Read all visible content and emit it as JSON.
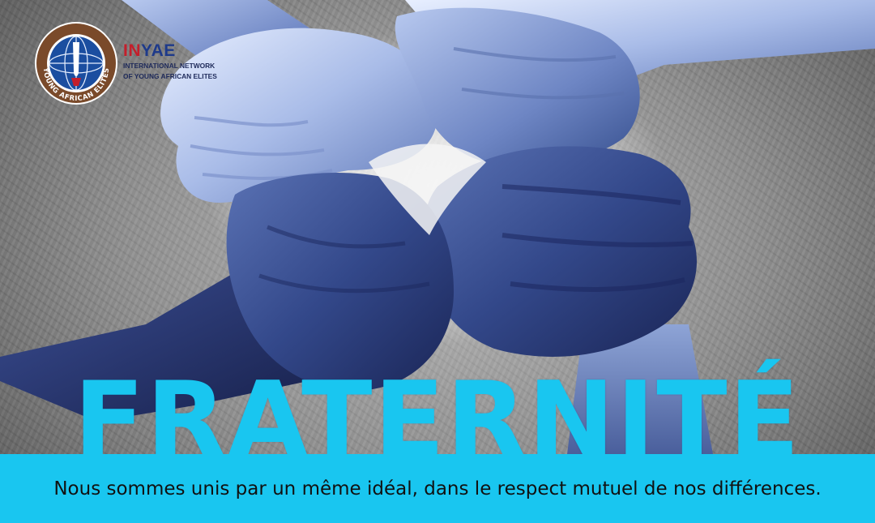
{
  "brand": {
    "logo_ring_text": "YOUNG AFRICAN ELITES",
    "acronym_part1": "IN",
    "acronym_part2": "YAE",
    "subtitle_line1": "INTERNATIONAL NETWORK",
    "subtitle_line2": "OF YOUNG AFRICAN ELITES"
  },
  "headline": "FRATERNITÉ",
  "caption": "Nous sommes unis par un même idéal, dans le respect mutuel de nos différences.",
  "colors": {
    "accent_cyan": "#19c6f0",
    "logo_navy": "#1e3a8a",
    "logo_red": "#c41e2b",
    "logo_brown": "#7a4a2a"
  }
}
